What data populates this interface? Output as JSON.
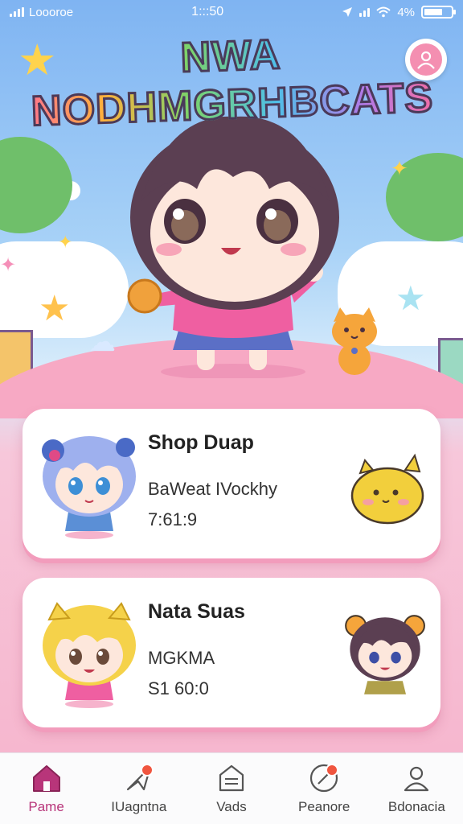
{
  "status_bar": {
    "carrier": "Loooroe",
    "time": "1:::50"
  },
  "app": {
    "title": "NWA NODHMGRHBCATS"
  },
  "cards": [
    {
      "title": "Shop Duap",
      "subtitle": "BaWeat IVockhy",
      "meta": "7:61:9"
    },
    {
      "title": "Nata Suas",
      "subtitle": "MGKMA",
      "meta": "S1 60:0"
    }
  ],
  "nav": {
    "items": [
      {
        "label": "Pame",
        "icon": "home-icon",
        "active": true
      },
      {
        "label": "IUagntna",
        "icon": "send-icon",
        "badge": true
      },
      {
        "label": "Vads",
        "icon": "store-icon"
      },
      {
        "label": "Peanore",
        "icon": "compass-icon",
        "badge": true
      },
      {
        "label": "Bdonacia",
        "icon": "person-icon"
      }
    ]
  },
  "colors": {
    "accent": "#b8357a",
    "card_shadow": "#f29cbc",
    "badge": "#f0553f"
  }
}
